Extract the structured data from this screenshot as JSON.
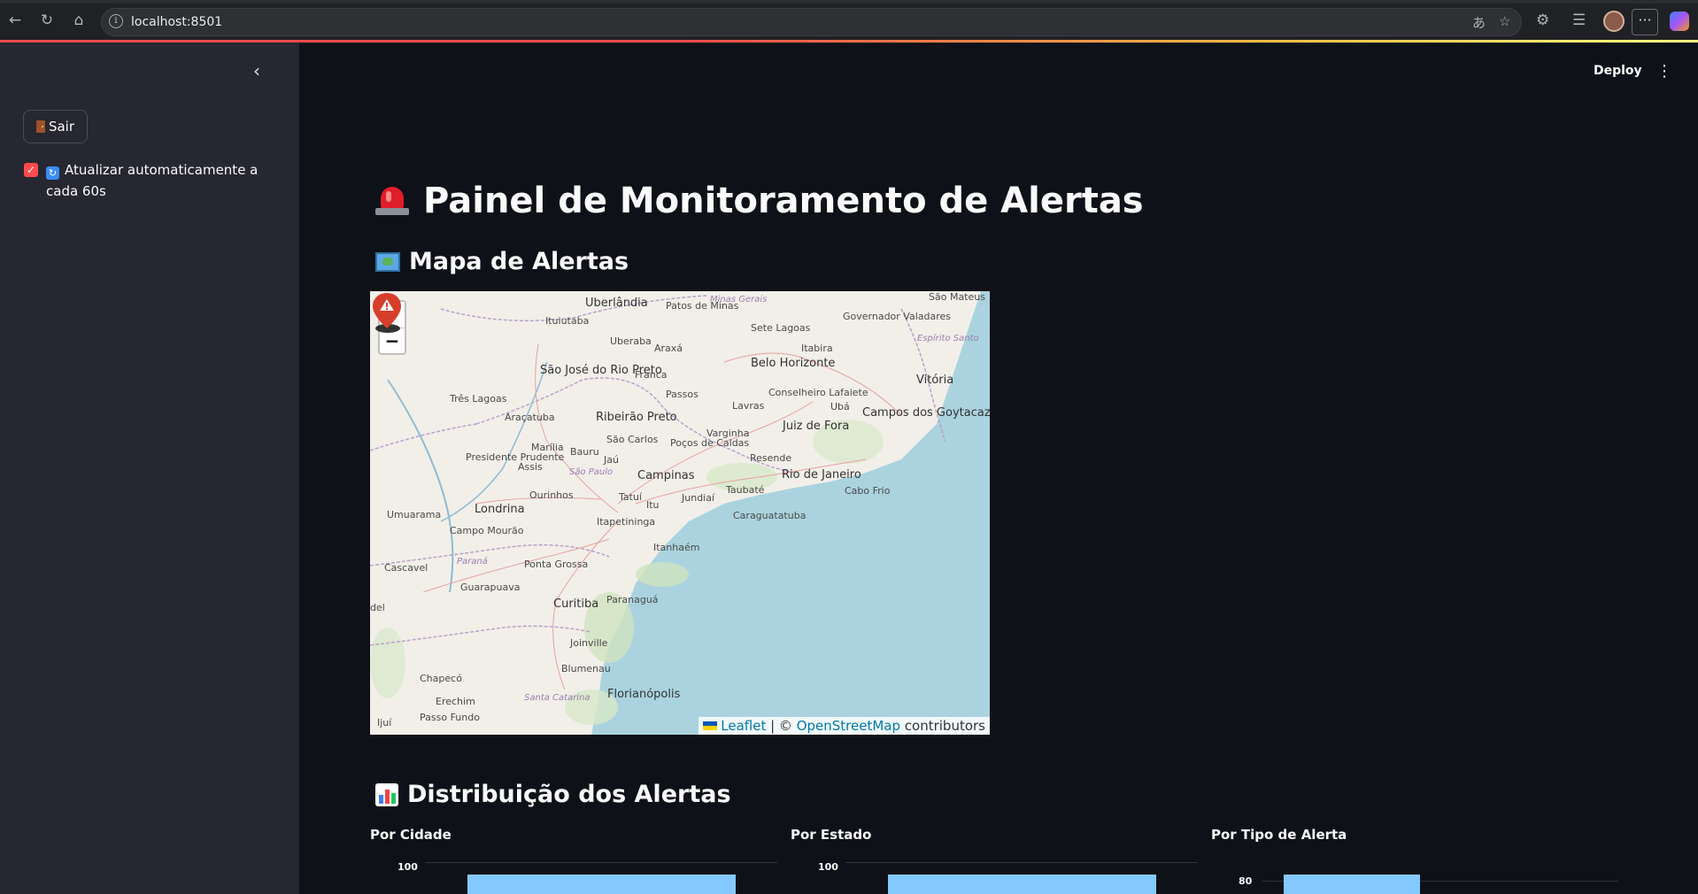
{
  "browser": {
    "url": "localhost:8501"
  },
  "sidebar": {
    "logout_label": "Sair",
    "auto_refresh_label": "Atualizar automaticamente a cada 60s",
    "auto_refresh_checked": true
  },
  "header": {
    "deploy_label": "Deploy"
  },
  "main": {
    "title": "Painel de Monitoramento de Alertas",
    "map_section_title": "Mapa de Alertas",
    "distribution_section_title": "Distribuição dos Alertas"
  },
  "map": {
    "zoom_in": "+",
    "zoom_out": "−",
    "attribution_leaflet": "Leaflet",
    "attribution_sep": " | © ",
    "attribution_osm": "OpenStreetMap",
    "attribution_suffix": " contributors",
    "labels": [
      "Uberlândia",
      "Patos de Minas",
      "Minas Gerais",
      "São Mateus",
      "Ituiutaba",
      "Sete Lagoas",
      "Governador Valadares",
      "Uberaba",
      "Araxá",
      "Itabira",
      "Espírito Santo",
      "São José do Rio Preto",
      "Franca",
      "Belo Horizonte",
      "Vitória",
      "Três Lagoas",
      "Passos",
      "Conselheiro Lafaiete",
      "Ubá",
      "Araçatuba",
      "Ribeirão Preto",
      "Lavras",
      "Campos dos Goytacazes",
      "Varginha",
      "Juiz de Fora",
      "Marília",
      "Bauru",
      "São Carlos",
      "Poços de Caldas",
      "Presidente Prudente",
      "Assis",
      "Jaú",
      "Resende",
      "Rio de Janeiro",
      "São Paulo",
      "Campinas",
      "Umuarama",
      "Londrina",
      "Ourinhos",
      "Tatuí",
      "Itu",
      "Jundiaí",
      "Taubaté",
      "Cabo Frio",
      "Campo Mourão",
      "Itapetininga",
      "Caraguatatuba",
      "Paraná",
      "Cascavel",
      "Ponta Grossa",
      "Itanhaém",
      "Guarapuava",
      "Curitiba",
      "Paranaguá",
      "Joinville",
      "Blumenau",
      "Chapecó",
      "Santa Catarina",
      "Florianópolis",
      "Erechim",
      "Passo Fundo",
      "Ijuí",
      "del"
    ]
  },
  "charts": [
    {
      "title": "Por Cidade",
      "top_tick": "100"
    },
    {
      "title": "Por Estado",
      "top_tick": "100"
    },
    {
      "title": "Por Tipo de Alerta",
      "top_tick": "80"
    }
  ],
  "colors": {
    "bar": "#83c9ff",
    "accent": "#ff4b4b",
    "background": "#0e1117",
    "sidebar": "#262730"
  }
}
